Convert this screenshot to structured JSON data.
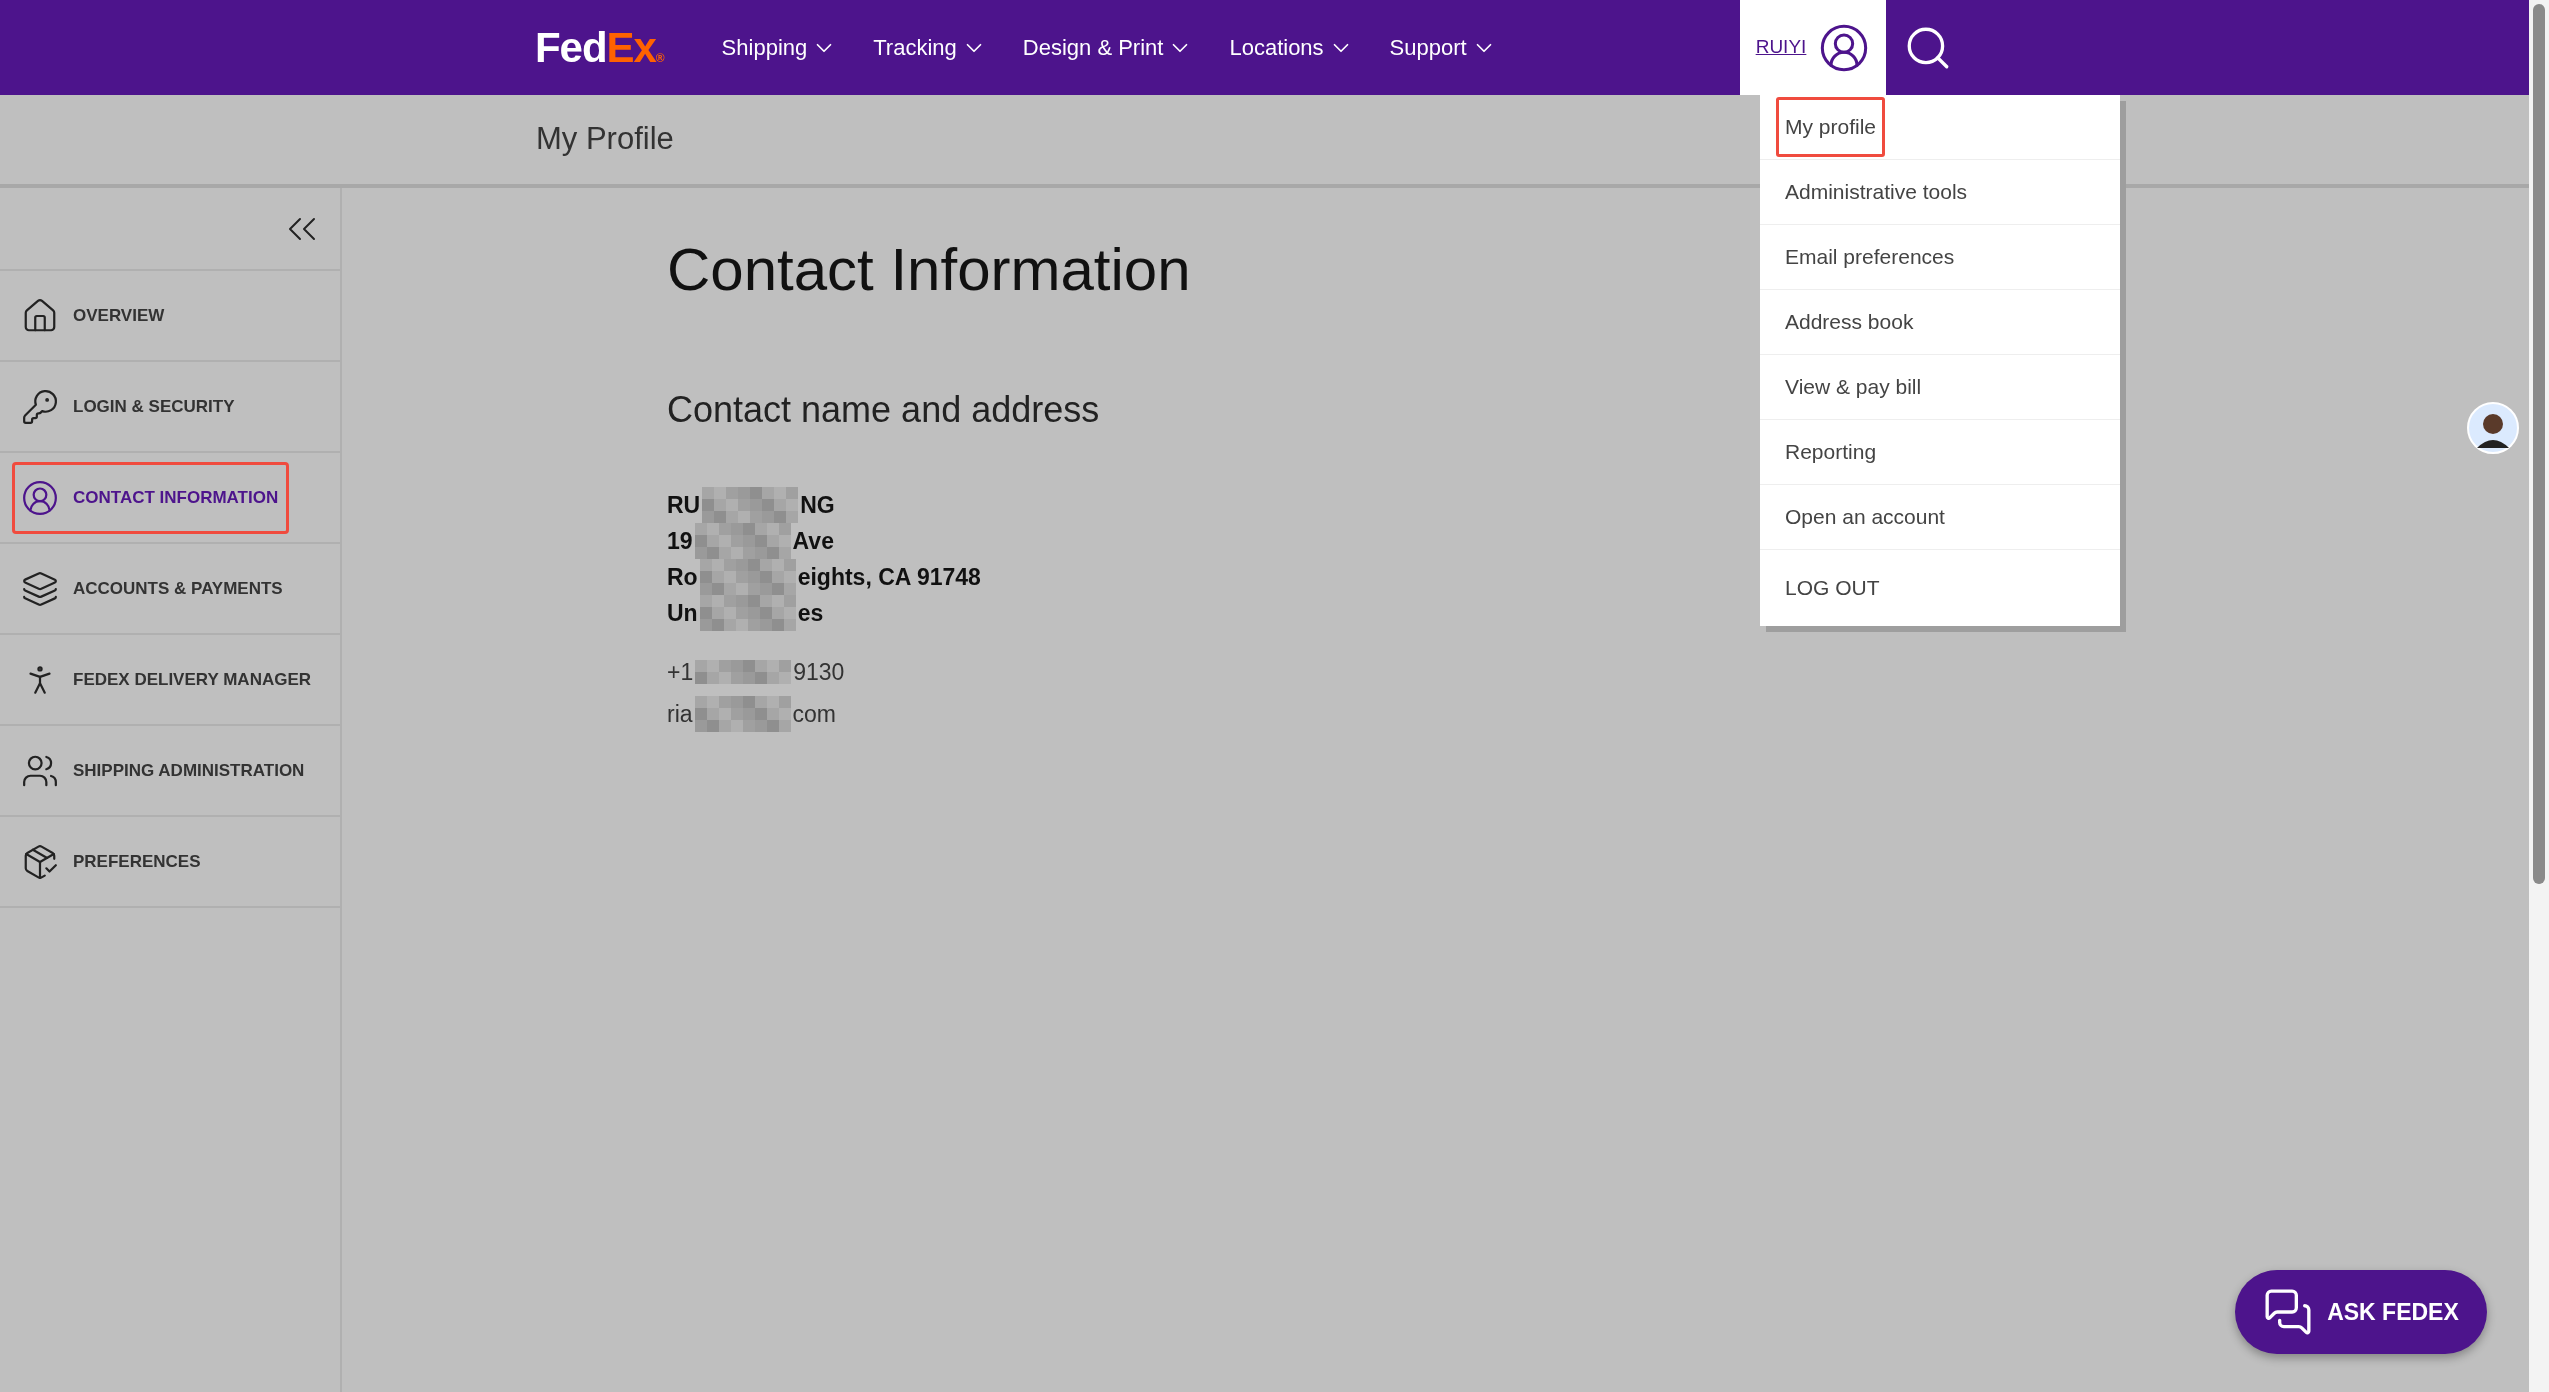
{
  "header": {
    "logo": {
      "first": "Fed",
      "second": "Ex",
      "mark": "®"
    },
    "nav": [
      {
        "label": "Shipping"
      },
      {
        "label": "Tracking"
      },
      {
        "label": "Design & Print"
      },
      {
        "label": "Locations"
      },
      {
        "label": "Support"
      }
    ],
    "user": {
      "name": "RUIYI",
      "expanded": true
    }
  },
  "page_title": "My Profile",
  "sidebar": {
    "items": [
      {
        "label": "OVERVIEW",
        "selected": false,
        "highlighted": false
      },
      {
        "label": "LOGIN & SECURITY",
        "selected": false,
        "highlighted": false
      },
      {
        "label": "CONTACT INFORMATION",
        "selected": true,
        "highlighted": true
      },
      {
        "label": "ACCOUNTS & PAYMENTS",
        "selected": false,
        "highlighted": false
      },
      {
        "label": "FEDEX DELIVERY MANAGER",
        "selected": false,
        "highlighted": false
      },
      {
        "label": "SHIPPING ADMINISTRATION",
        "selected": false,
        "highlighted": false
      },
      {
        "label": "PREFERENCES",
        "selected": false,
        "highlighted": false
      }
    ]
  },
  "main": {
    "title": "Contact Information",
    "section": "Contact name and address",
    "address_lines": [
      {
        "start": "RU",
        "end": "NG"
      },
      {
        "start": "19",
        "end": "Ave"
      },
      {
        "start": "Ro",
        "end": "eights, CA 91748"
      },
      {
        "start": "Un",
        "end": "es"
      }
    ],
    "phone": {
      "start": "+1",
      "end": "9130"
    },
    "email": {
      "start": "ria",
      "end": "com"
    }
  },
  "user_menu": {
    "items": [
      {
        "label": "My profile",
        "highlighted": true
      },
      {
        "label": "Administrative tools",
        "highlighted": false
      },
      {
        "label": "Email preferences",
        "highlighted": false
      },
      {
        "label": "Address book",
        "highlighted": false
      },
      {
        "label": "View & pay bill",
        "highlighted": false
      },
      {
        "label": "Reporting",
        "highlighted": false
      },
      {
        "label": "Open an account",
        "highlighted": false
      },
      {
        "label": "LOG OUT",
        "highlighted": false
      }
    ]
  },
  "chat_button": {
    "label": "ASK FEDEX"
  }
}
